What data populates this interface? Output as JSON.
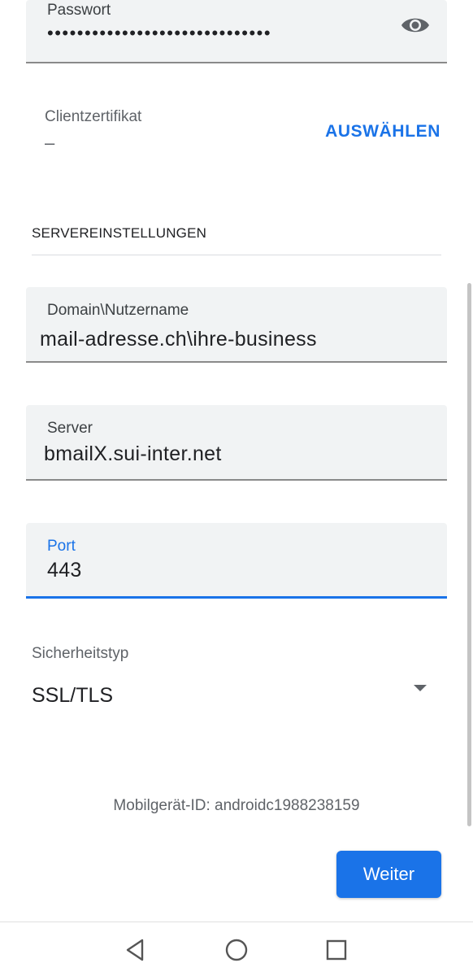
{
  "account": {
    "password_label": "Passwort",
    "password_value": "••••••••••••••••••••••••••••••",
    "client_cert_label": "Clientzertifikat",
    "client_cert_value": "–",
    "client_cert_action": "AUSWÄHLEN"
  },
  "server_settings": {
    "header": "SERVEREINSTELLUNGEN",
    "domain_label": "Domain\\Nutzername",
    "domain_value": "mail-adresse.ch\\ihre-business",
    "server_label": "Server",
    "server_value": "bmailX.sui-inter.net",
    "port_label": "Port",
    "port_value": "443",
    "security_label": "Sicherheitstyp",
    "security_value": "SSL/TLS"
  },
  "footer": {
    "device_id": "Mobilgerät-ID: androidc1988238159",
    "next_label": "Weiter"
  },
  "icons": {
    "password_toggle": "eye-icon",
    "dropdown": "dropdown-arrow-icon",
    "nav_back": "back-triangle-icon",
    "nav_home": "home-circle-icon",
    "nav_recents": "recents-square-icon"
  },
  "colors": {
    "accent": "#1a73e8",
    "field_background": "#f1f3f4"
  }
}
